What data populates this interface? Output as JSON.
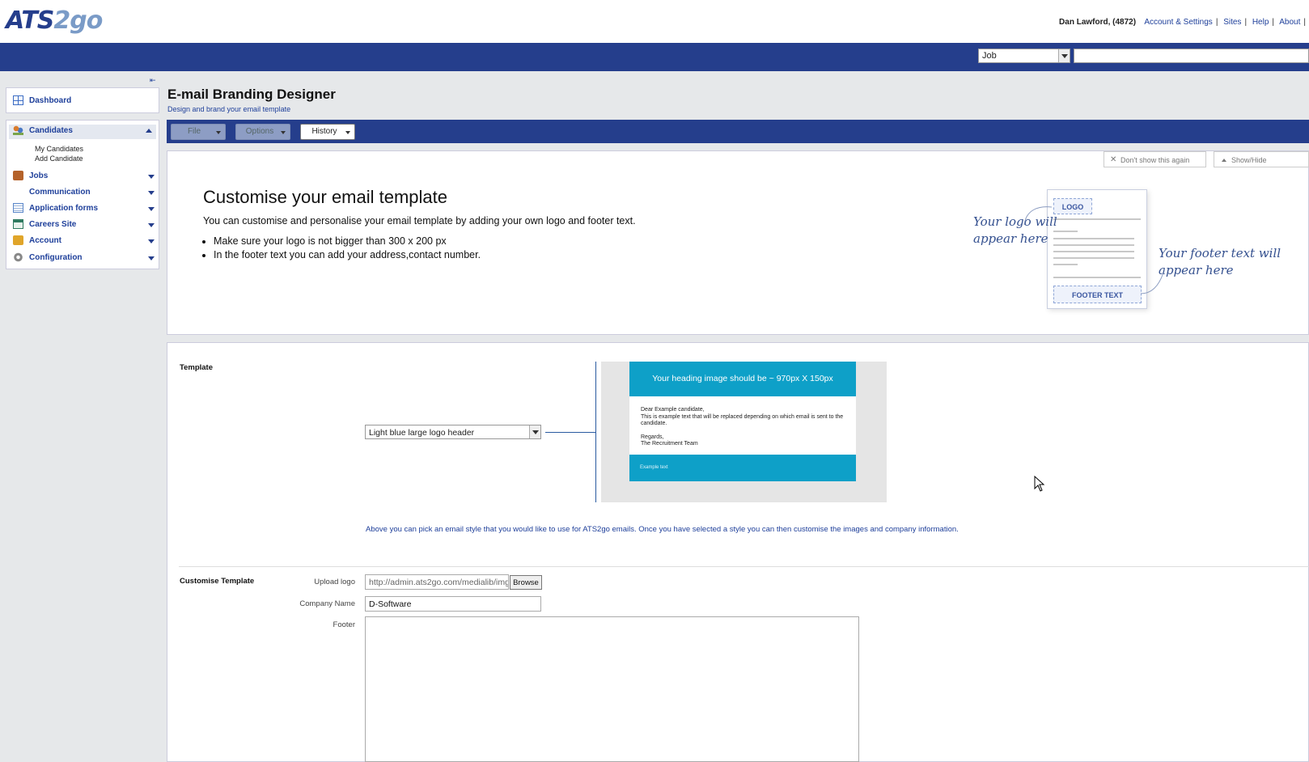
{
  "brand": {
    "logo_part1": "ATS",
    "logo_part2": "2go"
  },
  "user_nav": {
    "user": "Dan Lawford, (4872)",
    "links": [
      "Account & Settings",
      "Sites",
      "Help",
      "About"
    ]
  },
  "search": {
    "type_value": "Job",
    "query": ""
  },
  "sidebar": {
    "dashboard": "Dashboard",
    "items": [
      {
        "label": "Candidates",
        "icon": "people-icon"
      },
      {
        "label": "Jobs",
        "icon": "briefcase-icon"
      },
      {
        "label": "Communication",
        "icon": ""
      },
      {
        "label": "Application forms",
        "icon": "form-icon"
      },
      {
        "label": "Careers Site",
        "icon": "site-icon"
      },
      {
        "label": "Account",
        "icon": "lock-icon"
      },
      {
        "label": "Configuration",
        "icon": "gear-icon"
      }
    ],
    "candidates_sub": [
      "My Candidates",
      "Add Candidate"
    ]
  },
  "page": {
    "title": "E-mail Branding Designer",
    "subtitle": "Design and brand your email template"
  },
  "toolbar": {
    "file": "File",
    "options": "Options",
    "history": "History"
  },
  "intro": {
    "dont_show": "Don't show this again",
    "show_hide": "Show/Hide",
    "heading": "Customise your email template",
    "paragraph": "You can customise and personalise your email template by adding your own logo and footer text.",
    "bullets": [
      "Make sure your logo is not bigger than 300 x 200 px",
      "In the footer text you can add your address,contact number."
    ],
    "illustration": {
      "logo": "LOGO",
      "footer": "FOOTER TEXT",
      "logo_note_1": "Your logo will",
      "logo_note_2": "appear here",
      "footer_note_1": "Your footer text will",
      "footer_note_2": "appear here"
    }
  },
  "template": {
    "label": "Template",
    "selected": "Light blue large logo header",
    "preview": {
      "heading": "Your heading image should be ~ 970px X 150px",
      "body_lines": [
        "Dear Example candidate,",
        "This is example text that will be replaced depending on which email is sent to the",
        "candidate.",
        "",
        "Regards,",
        "The Recruitment Team"
      ],
      "footer": "Example text"
    },
    "help": "Above you can pick an email style that you would like to use for ATS2go emails. Once you have selected a style you can then customise the images and company information."
  },
  "customise": {
    "label": "Customise Template",
    "upload_logo_label": "Upload logo",
    "upload_logo_value": "http://admin.ats2go.com/medialib/img",
    "browse": "Browse",
    "company_name_label": "Company Name",
    "company_name_value": "D-Software",
    "footer_label": "Footer",
    "footer_value": ""
  },
  "colors": {
    "brand_blue": "#253e8c",
    "preview_blue": "#0ea0c8",
    "link_blue": "#1e3f9a"
  }
}
